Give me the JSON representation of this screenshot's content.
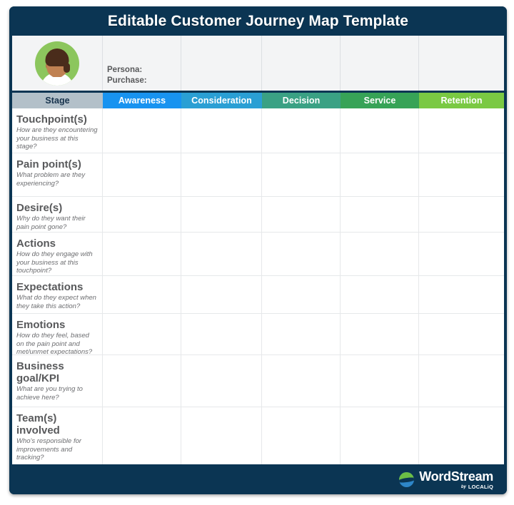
{
  "header": {
    "title": "Editable Customer Journey Map Template"
  },
  "persona": {
    "avatar_icon": "person-avatar-icon",
    "fields": [
      {
        "label": "Persona:",
        "value": ""
      },
      {
        "label": "Purchase:",
        "value": ""
      }
    ]
  },
  "columns": [
    {
      "key": "stage",
      "label": "Stage",
      "color": "#b3c0c9"
    },
    {
      "key": "awareness",
      "label": "Awareness",
      "color": "#1893f0"
    },
    {
      "key": "consideration",
      "label": "Consideration",
      "color": "#2a9fd4"
    },
    {
      "key": "decision",
      "label": "Decision",
      "color": "#3aa184"
    },
    {
      "key": "service",
      "label": "Service",
      "color": "#37a357"
    },
    {
      "key": "retention",
      "label": "Retention",
      "color": "#7ac943"
    }
  ],
  "rows": [
    {
      "title": "Touchpoint(s)",
      "desc": "How are they encountering your business at this stage?"
    },
    {
      "title": "Pain point(s)",
      "desc": "What problem are they experiencing?"
    },
    {
      "title": "Desire(s)",
      "desc": "Why do they want their pain point gone?"
    },
    {
      "title": "Actions",
      "desc": "How do they engage with your business at this touchpoint?"
    },
    {
      "title": "Expectations",
      "desc": "What do they expect when they take this action?"
    },
    {
      "title": "Emotions",
      "desc": "How do they feel, based on the pain point and met/unmet expectations?"
    },
    {
      "title": "Business goal/KPI",
      "desc": "What are you trying to achieve here?"
    },
    {
      "title": "Team(s) involved",
      "desc": "Who's responsible for improvements and tracking?"
    }
  ],
  "footer": {
    "logo_mark_icon": "wordstream-globe-icon",
    "brand": "WordStream",
    "by": "by",
    "parent_brand": "LOCALiQ"
  },
  "theme": {
    "navy": "#0b3553",
    "panel_gray": "#f3f4f5",
    "title_text": "#ffffff",
    "row_title_text": "#58595b",
    "row_desc_text": "#6d6e71",
    "grid_line": "#e6e8ea"
  }
}
